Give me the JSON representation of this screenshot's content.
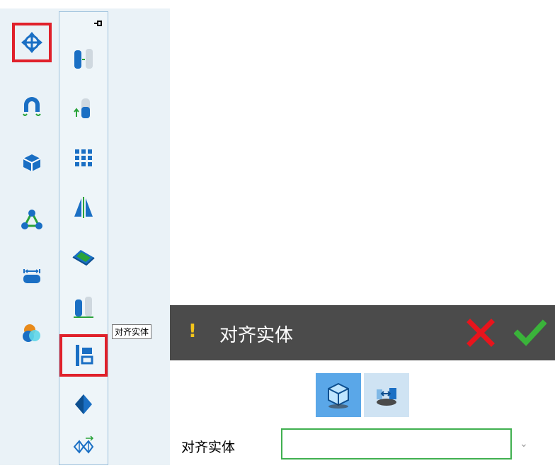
{
  "tooltip": {
    "text": "对齐实体"
  },
  "panel": {
    "warning_mark": "!",
    "title": "对齐实体",
    "field_label": "对齐实体",
    "field_value": "",
    "dropdown_glyph": "⌄"
  },
  "colors": {
    "selected_border": "#e0212b",
    "panel_header": "#4b4b4b",
    "cancel": "#e8141c",
    "ok": "#3ab33a",
    "icon_blue": "#1a6fc4",
    "icon_green": "#2aa33a",
    "field_border": "#40b050"
  },
  "toolbar_primary": {
    "items": [
      {
        "name": "move-icon",
        "selected": true
      },
      {
        "name": "magnet-icon",
        "selected": false
      },
      {
        "name": "box-icon",
        "selected": false
      },
      {
        "name": "constraint-icon",
        "selected": false
      },
      {
        "name": "measure-icon",
        "selected": false
      },
      {
        "name": "color-icon",
        "selected": false
      }
    ]
  },
  "toolbar_secondary": {
    "items": [
      {
        "name": "pattern-cylinder-icon",
        "selected": false
      },
      {
        "name": "translate-cylinder-icon",
        "selected": false
      },
      {
        "name": "array-icon",
        "selected": false
      },
      {
        "name": "mirror-icon",
        "selected": false
      },
      {
        "name": "slice-icon",
        "selected": false
      },
      {
        "name": "align-cylinders-icon",
        "selected": false
      },
      {
        "name": "align-entity-icon",
        "selected": true
      },
      {
        "name": "diamond-icon",
        "selected": false
      },
      {
        "name": "transform-icon",
        "selected": false
      }
    ]
  }
}
